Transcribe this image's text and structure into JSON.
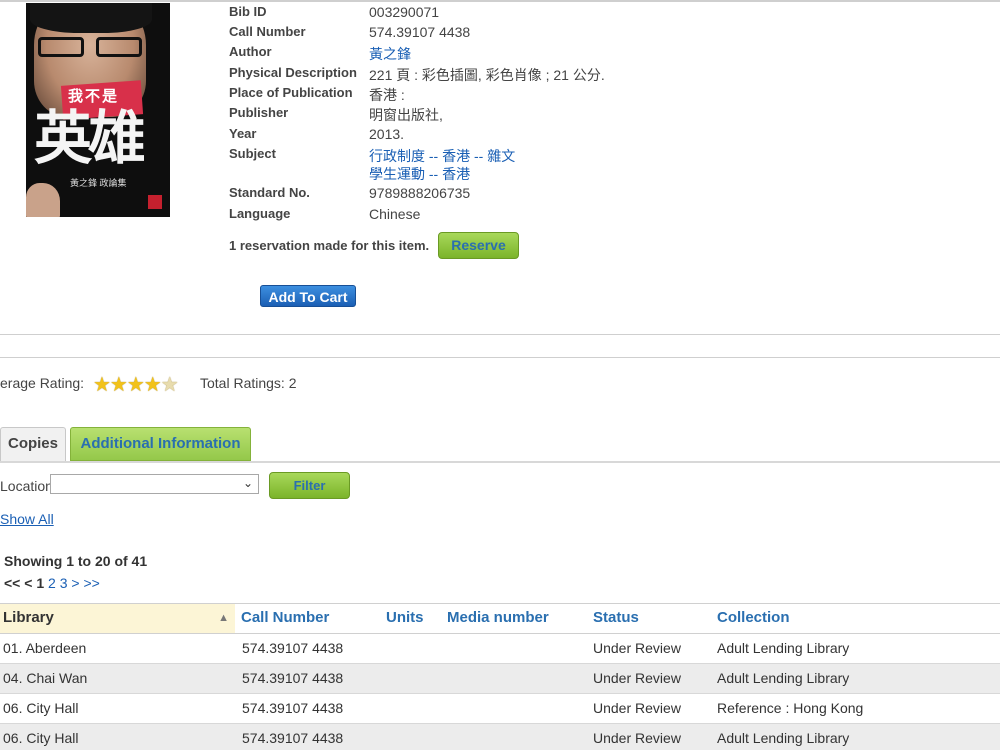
{
  "record": {
    "fields": [
      {
        "label": "Bib ID",
        "value": "003290071"
      },
      {
        "label": "Call Number",
        "value": "574.39107 4438"
      },
      {
        "label": "Author",
        "value": "黃之鋒",
        "link": true
      },
      {
        "label": "Physical Description",
        "value": "221 頁 : 彩色插圖, 彩色肖像 ; 21 公分."
      },
      {
        "label": "Place of Publication",
        "value": "香港 :"
      },
      {
        "label": "Publisher",
        "value": "明窗出版社,"
      },
      {
        "label": "Year",
        "value": "2013."
      },
      {
        "label": "Subject",
        "value": "行政制度 --  香港 --  雜文",
        "value2": "學生運動 --  香港",
        "link": true
      },
      {
        "label": "Standard No.",
        "value": "9789888206735"
      },
      {
        "label": "Language",
        "value": "Chinese"
      }
    ],
    "cover": {
      "small_title": "我不是",
      "big_title": "英雄",
      "author_line": "黃之鋒 政論集"
    }
  },
  "reservation": {
    "text": "1 reservation made for this item.",
    "reserve_label": "Reserve",
    "add_to_cart_label": "Add To Cart"
  },
  "rating": {
    "label": "erage Rating:",
    "stars_value": 4.5,
    "total_label": "Total Ratings: 2"
  },
  "tabs": [
    {
      "label": "Copies",
      "active": false
    },
    {
      "label": "Additional Information",
      "active": true
    }
  ],
  "filter": {
    "location_label": "Location",
    "location_value": "",
    "filter_label": "Filter",
    "show_all_label": "Show All"
  },
  "results": {
    "showing_text": "Showing 1 to 20 of 41",
    "pager": {
      "first": "<<",
      "prev": "<",
      "current": "1",
      "pages": [
        "2",
        "3"
      ],
      "next": ">",
      "last": ">>"
    }
  },
  "table": {
    "headers": {
      "library": "Library",
      "call_number": "Call Number",
      "units": "Units",
      "media_number": "Media number",
      "status": "Status",
      "collection": "Collection"
    },
    "rows": [
      {
        "library": "01. Aberdeen",
        "call_number": "574.39107 4438",
        "units": "",
        "media_number": "",
        "status": "Under Review",
        "collection": "Adult Lending Library"
      },
      {
        "library": "04. Chai Wan",
        "call_number": "574.39107 4438",
        "units": "",
        "media_number": "",
        "status": "Under Review",
        "collection": "Adult Lending Library"
      },
      {
        "library": "06. City Hall",
        "call_number": "574.39107 4438",
        "units": "",
        "media_number": "",
        "status": "Under Review",
        "collection": "Reference : Hong Kong"
      },
      {
        "library": "06. City Hall",
        "call_number": "574.39107 4438",
        "units": "",
        "media_number": "",
        "status": "Under Review",
        "collection": "Adult Lending Library"
      }
    ]
  },
  "colors": {
    "link": "#1a5fb4",
    "green_button": "#94c84a",
    "blue_button": "#1b5fb4",
    "star": "#f2c21a"
  }
}
